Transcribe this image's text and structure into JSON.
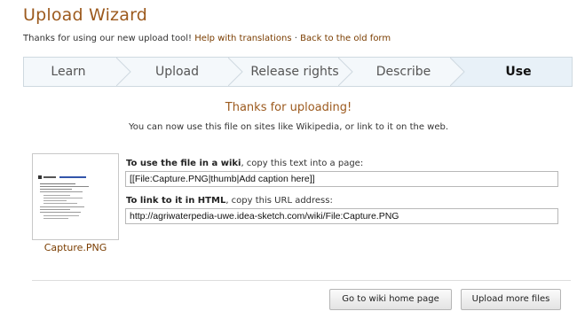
{
  "header": {
    "title": "Upload Wizard",
    "thanks_text": "Thanks for using our new upload tool!",
    "help_link": "Help with translations",
    "separator": "·",
    "old_form_link": "Back to the old form"
  },
  "steps": [
    {
      "label": "Learn"
    },
    {
      "label": "Upload"
    },
    {
      "label": "Release rights"
    },
    {
      "label": "Describe"
    },
    {
      "label": "Use",
      "active": true
    }
  ],
  "main": {
    "thanks_heading": "Thanks for uploading!",
    "thanks_body": "You can now use this file on sites like Wikipedia, or link to it on the web."
  },
  "file": {
    "name": "Capture.PNG",
    "wiki_label_bold": "To use the file in a wiki",
    "wiki_label_rest": ", copy this text into a page:",
    "wiki_text": "[[File:Capture.PNG|thumb|Add caption here]]",
    "html_label_bold": "To link to it in HTML",
    "html_label_rest": ", copy this URL address:",
    "html_url": "http://agriwaterpedia-uwe.idea-sketch.com/wiki/File:Capture.PNG"
  },
  "buttons": {
    "home": "Go to wiki home page",
    "more": "Upload more files"
  },
  "colors": {
    "accent": "#9c5a1e",
    "link": "#7a3d00",
    "step_bg": "#f4f8fb",
    "step_active_bg": "#e8f1f8"
  }
}
